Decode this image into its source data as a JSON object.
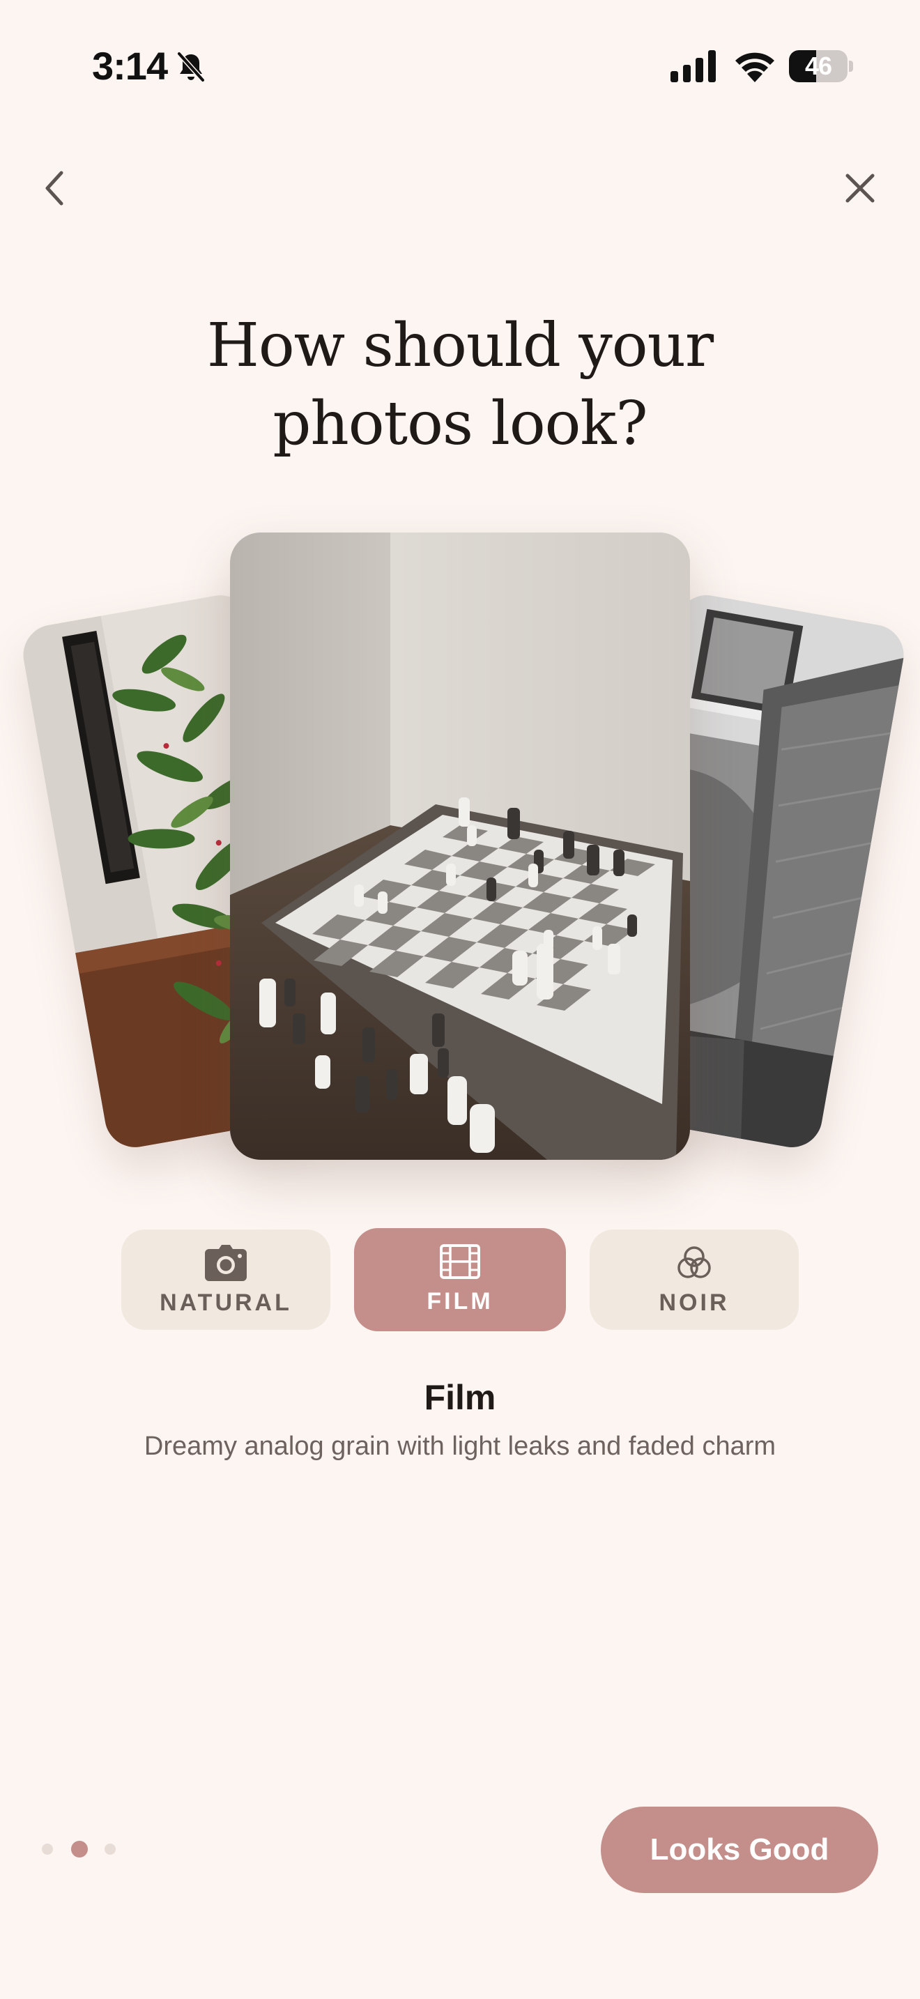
{
  "status_bar": {
    "time": "3:14",
    "battery_level": "46",
    "battery_fraction": 0.46,
    "icons": [
      "bell-slash-icon",
      "cellular-signal-icon",
      "wifi-icon",
      "battery-icon"
    ]
  },
  "nav": {
    "back_icon": "chevron-left-icon",
    "close_icon": "close-icon"
  },
  "title": {
    "line1": "How should your",
    "line2": "photos look?"
  },
  "carousel": {
    "cards": [
      {
        "position": "left",
        "subject": "houseplant"
      },
      {
        "position": "center",
        "subject": "chess-board"
      },
      {
        "position": "right",
        "subject": "chair"
      }
    ]
  },
  "filters": {
    "options": [
      {
        "label": "NATURAL",
        "icon": "camera-icon",
        "selected": false
      },
      {
        "label": "FILM",
        "icon": "film-icon",
        "selected": true
      },
      {
        "label": "NOIR",
        "icon": "overlapping-circles-icon",
        "selected": false
      }
    ],
    "selected_name": "Film",
    "selected_description": "Dreamy analog grain with light leaks and faded charm"
  },
  "pagination": {
    "total": 3,
    "current": 2
  },
  "primary_action": {
    "label": "Looks Good"
  },
  "colors": {
    "background": "#fcf5f1",
    "accent": "#c48f8b",
    "option_background": "#f1e8e0",
    "option_text": "#6a5f59"
  }
}
